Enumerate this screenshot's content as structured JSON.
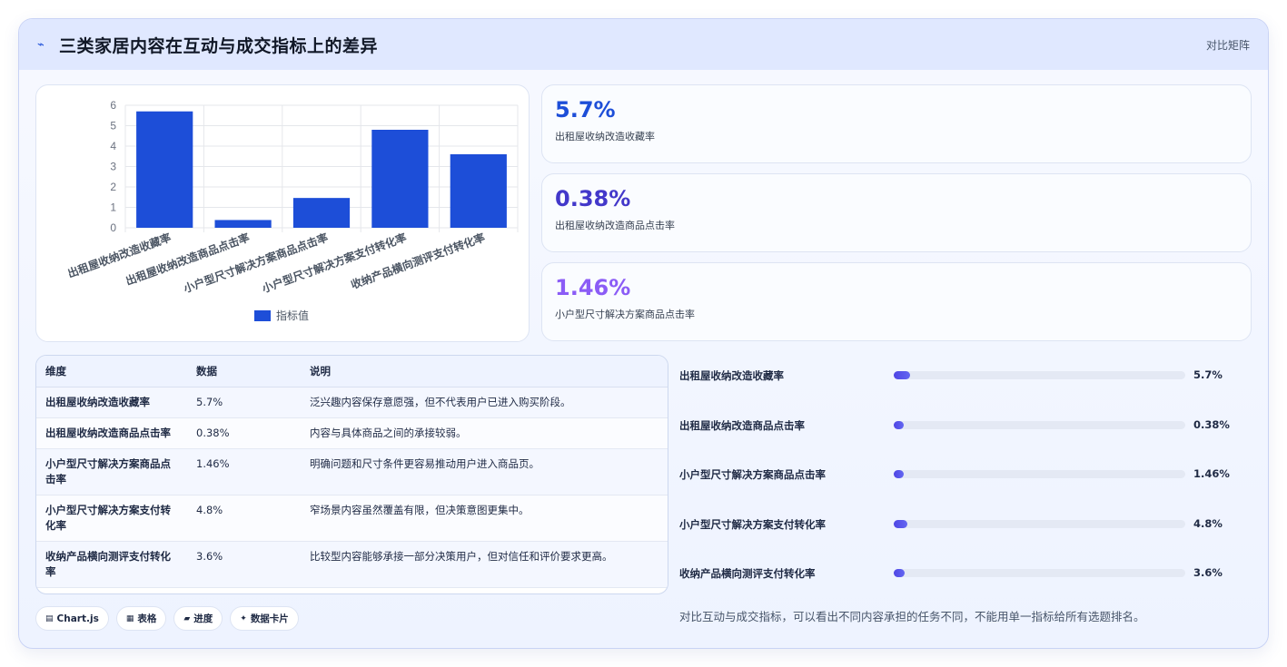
{
  "header": {
    "title": "三类家居内容在互动与成交指标上的差异",
    "tag": "对比矩阵",
    "icon": "spark-icon"
  },
  "chart_data": {
    "type": "bar",
    "categories": [
      "出租屋收纳改造收藏率",
      "出租屋收纳改造商品点击率",
      "小户型尺寸解决方案商品点击率",
      "小户型尺寸解决方案支付转化率",
      "收纳产品横向测评支付转化率"
    ],
    "series": [
      {
        "name": "指标值",
        "values": [
          5.7,
          0.38,
          1.46,
          4.8,
          3.6
        ]
      }
    ],
    "ylim": [
      0,
      6
    ],
    "yticks": [
      0,
      1,
      2,
      3,
      4,
      5,
      6
    ],
    "grid": true,
    "legend": "bottom",
    "bar_color": "#1d4ed8"
  },
  "stats": [
    {
      "value": "5.7%",
      "label": "出租屋收纳改造收藏率",
      "color": "#1d4ed8"
    },
    {
      "value": "0.38%",
      "label": "出租屋收纳改造商品点击率",
      "color": "#4338ca"
    },
    {
      "value": "1.46%",
      "label": "小户型尺寸解决方案商品点击率",
      "color": "#8b5cf6"
    }
  ],
  "table": {
    "headers": [
      "维度",
      "数据",
      "说明"
    ],
    "rows": [
      [
        "出租屋收纳改造收藏率",
        "5.7%",
        "泛兴趣内容保存意愿强，但不代表用户已进入购买阶段。"
      ],
      [
        "出租屋收纳改造商品点击率",
        "0.38%",
        "内容与具体商品之间的承接较弱。"
      ],
      [
        "小户型尺寸解决方案商品点击率",
        "1.46%",
        "明确问题和尺寸条件更容易推动用户进入商品页。"
      ],
      [
        "小户型尺寸解决方案支付转化率",
        "4.8%",
        "窄场景内容虽然覆盖有限，但决策意图更集中。"
      ],
      [
        "收纳产品横向测评支付转化率",
        "3.6%",
        "比较型内容能够承接一部分决策用户，但对信任和评价要求更高。"
      ]
    ]
  },
  "progress": {
    "scale_max": 100,
    "items": [
      {
        "label": "出租屋收纳改造收藏率",
        "value_text": "5.7%",
        "value": 5.7
      },
      {
        "label": "出租屋收纳改造商品点击率",
        "value_text": "0.38%",
        "value": 0.38
      },
      {
        "label": "小户型尺寸解决方案商品点击率",
        "value_text": "1.46%",
        "value": 1.46
      },
      {
        "label": "小户型尺寸解决方案支付转化率",
        "value_text": "4.8%",
        "value": 4.8
      },
      {
        "label": "收纳产品横向测评支付转化率",
        "value_text": "3.6%",
        "value": 3.6
      }
    ]
  },
  "chips": [
    {
      "icon": "chart-icon",
      "label": "Chart.js"
    },
    {
      "icon": "table-icon",
      "label": "表格"
    },
    {
      "icon": "progress-icon",
      "label": "进度"
    },
    {
      "icon": "card-icon",
      "label": "数据卡片"
    }
  ],
  "footnote": "对比互动与成交指标，可以看出不同内容承担的任务不同，不能用单一指标给所有选题排名。"
}
